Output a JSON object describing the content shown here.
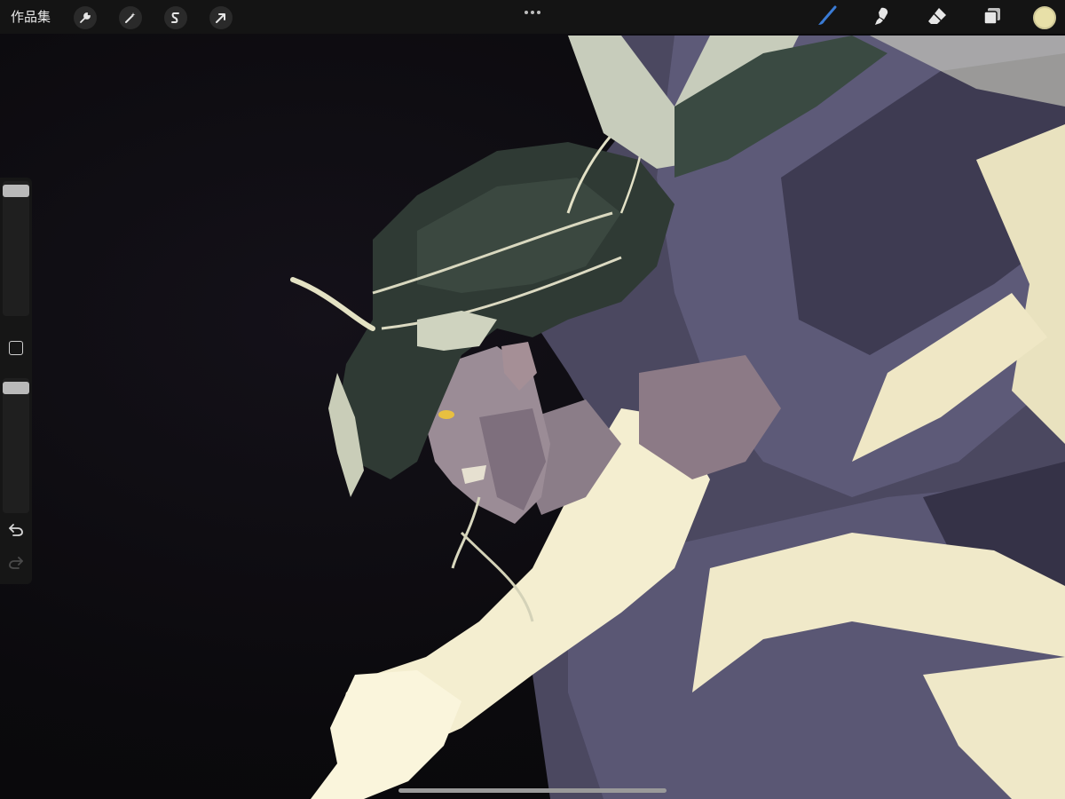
{
  "topbar": {
    "gallery_label": "作品集",
    "left_tools": [
      {
        "name": "actions",
        "icon": "wrench-icon"
      },
      {
        "name": "adjustments",
        "icon": "magic-wand-icon"
      },
      {
        "name": "selection",
        "icon": "selection-s-icon"
      },
      {
        "name": "transform",
        "icon": "arrow-cursor-icon"
      }
    ],
    "more_icon": "ellipsis-icon",
    "right_tools": [
      {
        "name": "brush",
        "icon": "brush-icon",
        "active": true,
        "color": "#3a7bd5"
      },
      {
        "name": "smudge",
        "icon": "smudge-icon",
        "active": false
      },
      {
        "name": "eraser",
        "icon": "eraser-icon",
        "active": false
      },
      {
        "name": "layers",
        "icon": "layers-icon",
        "active": false
      }
    ],
    "current_color": "#e8e0a8"
  },
  "sidebar": {
    "brush_size_level": 1.0,
    "opacity_level": 1.0,
    "modify_icon": "square-modify-icon",
    "undo_icon": "undo-icon",
    "redo_icon": "redo-icon",
    "redo_enabled": false
  },
  "canvas": {
    "background_color": "#0b0a0d",
    "palette": {
      "hair_dark": "#2f3a34",
      "hair_light": "#c9cdb8",
      "cape_purple": "#4b4860",
      "cape_light": "#6c6a86",
      "highlight": "#f3ecc8",
      "skin": "#9b8c96",
      "eye": "#e8c040"
    }
  }
}
